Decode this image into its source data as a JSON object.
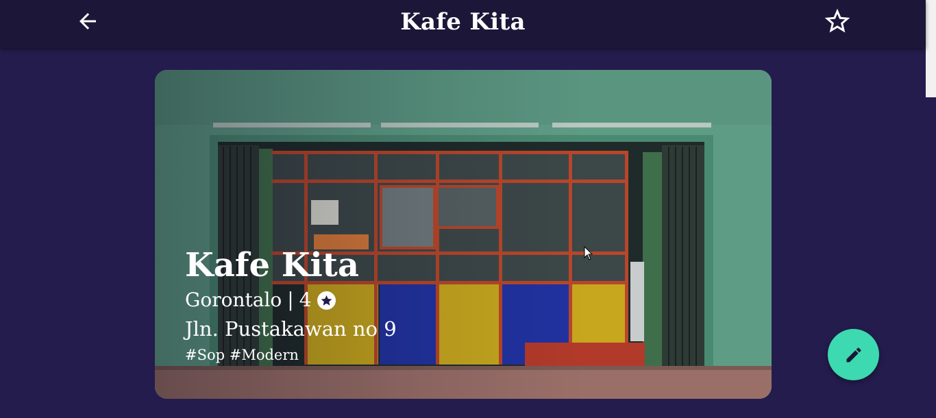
{
  "appbar": {
    "title": "Kafe Kita",
    "back_icon": "arrow-back-icon",
    "favorite_icon": "star-outline-icon"
  },
  "place": {
    "name": "Kafe Kita",
    "city": "Gorontalo",
    "separator": "|",
    "rating": "4",
    "rating_icon": "star-circle-icon",
    "address": "Jln. Pustakawan no 9",
    "tags": "#Sop #Modern"
  },
  "fab": {
    "icon": "pencil-edit-icon",
    "color": "#3dd9b0"
  },
  "colors": {
    "background": "#241c4c",
    "appbar": "#1c1738",
    "accent": "#3dd9b0"
  }
}
